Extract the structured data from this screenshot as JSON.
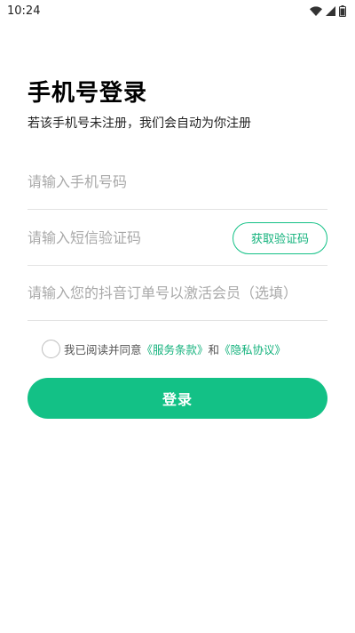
{
  "status_bar": {
    "time": "10:24",
    "icons": [
      "wifi-icon",
      "cell-signal-icon",
      "battery-icon"
    ]
  },
  "header": {
    "title": "手机号登录",
    "subtitle": "若该手机号未注册，我们会自动为你注册"
  },
  "form": {
    "phone_placeholder": "请输入手机号码",
    "code_placeholder": "请输入短信验证码",
    "get_code_label": "获取验证码",
    "order_placeholder": "请输入您的抖音订单号以激活会员（选填）"
  },
  "agreement": {
    "prefix": "我已阅读并同意",
    "terms_link": "《服务条款》",
    "conjunction": "和",
    "privacy_link": "《隐私协议》"
  },
  "login": {
    "label": "登录"
  },
  "colors": {
    "accent": "#13c186",
    "accent_text": "#13b27c",
    "placeholder": "#a9a9a9",
    "divider": "#e3e3e3"
  }
}
